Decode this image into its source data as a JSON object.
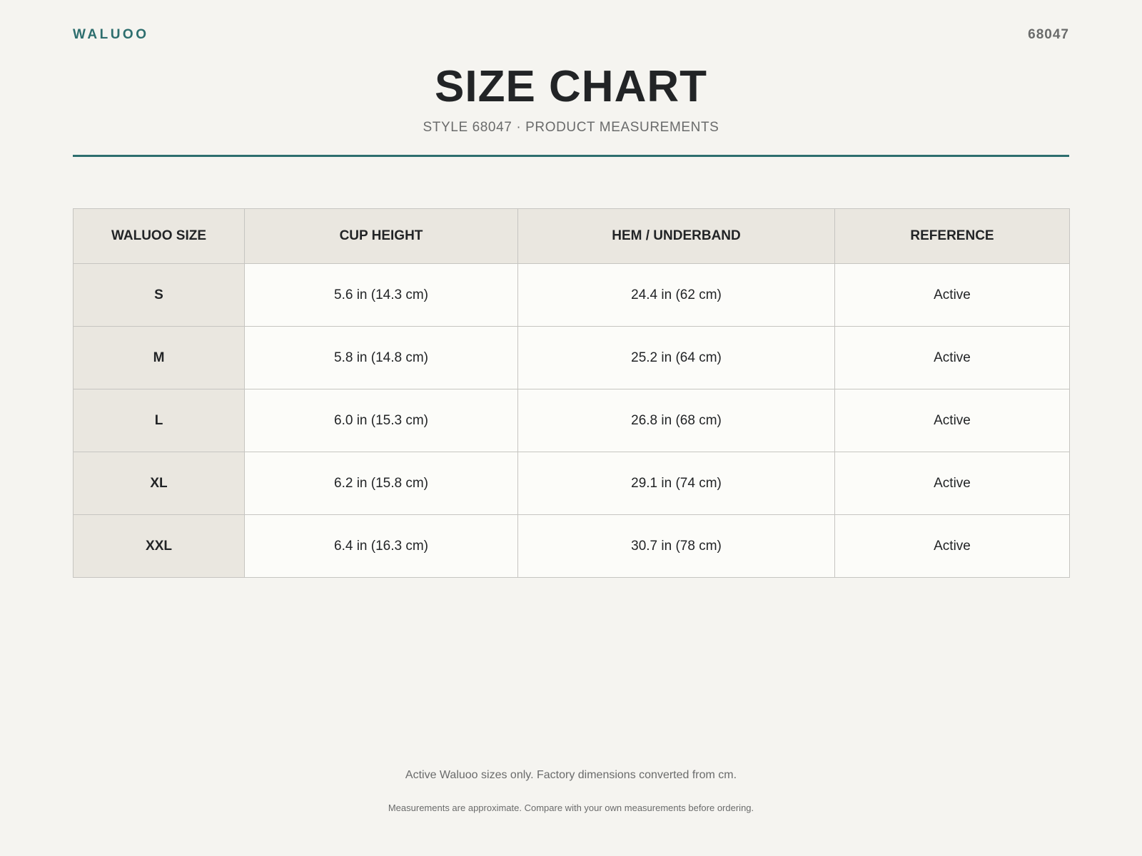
{
  "header": {
    "brand": "WALUOO",
    "style_code": "68047",
    "title": "SIZE CHART",
    "subtitle": "STYLE 68047 · PRODUCT MEASUREMENTS"
  },
  "table": {
    "columns": [
      "WALUOO SIZE",
      "CUP HEIGHT",
      "HEM / UNDERBAND",
      "REFERENCE"
    ],
    "rows": [
      [
        "S",
        "5.6 in (14.3 cm)",
        "24.4 in (62 cm)",
        "Active"
      ],
      [
        "M",
        "5.8 in (14.8 cm)",
        "25.2 in (64 cm)",
        "Active"
      ],
      [
        "L",
        "6.0 in (15.3 cm)",
        "26.8 in (68 cm)",
        "Active"
      ],
      [
        "XL",
        "6.2 in (15.8 cm)",
        "29.1 in (74 cm)",
        "Active"
      ],
      [
        "XXL",
        "6.4 in (16.3 cm)",
        "30.7 in (78 cm)",
        "Active"
      ]
    ]
  },
  "footer": {
    "note_primary": "Active Waluoo sizes only. Factory dimensions converted from cm.",
    "note_secondary": "Measurements are approximate. Compare with your own measurements before ordering."
  },
  "colors": {
    "accent": "#2d6e6e",
    "background": "#f5f4f0",
    "header_cell": "#eae7e0",
    "body_cell": "#fcfcf9"
  }
}
